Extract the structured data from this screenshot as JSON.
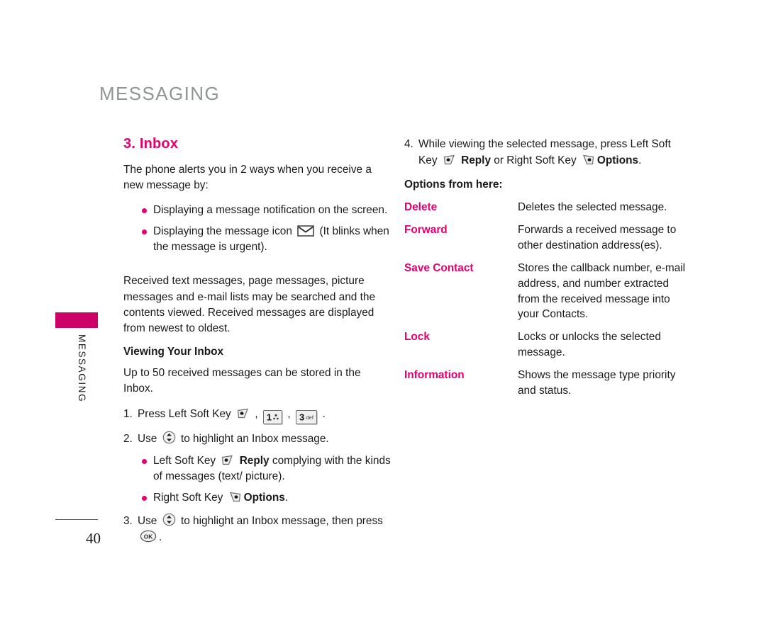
{
  "page": {
    "chapter_title": "MESSAGING",
    "side_tab_label": "MESSAGING",
    "page_number": "40",
    "accent_color": "#E4006D",
    "tab_color": "#CC0066",
    "chapter_title_color": "#8F9591"
  },
  "left": {
    "section_heading": "3. Inbox",
    "intro": "The phone alerts you in 2 ways when you receive a new message by:",
    "alert_bullets": [
      {
        "before": "Displaying a message notification on the screen.",
        "icon": null,
        "after": ""
      },
      {
        "before": "Displaying the message icon",
        "icon": "envelope-icon",
        "after": "(It blinks when the message is urgent)."
      }
    ],
    "paragraph_received": "Received text messages, page messages, picture messages and e-mail lists may be searched and the contents viewed. Received messages are displayed from newest to oldest.",
    "subhead_viewing": "Viewing Your Inbox",
    "paragraph_capacity": "Up to 50 received messages can be stored in the Inbox.",
    "steps": [
      {
        "num": "1.",
        "text_before": "Press Left Soft Key",
        "icons": [
          "left-soft-key-icon",
          "key-1-icon",
          "key-3-icon"
        ],
        "text_after": "."
      },
      {
        "num": "2.",
        "text_before": "Use",
        "icons": [
          "nav-up-down-icon"
        ],
        "text_after": "to highlight an Inbox message."
      },
      {
        "num": "3.",
        "text_before": "Use",
        "icons": [
          "nav-up-down-icon"
        ],
        "text_after": "to highlight an Inbox message, then press",
        "trailing_icon": "ok-key-icon",
        "trailing_text": "."
      }
    ],
    "softkey_bullets": [
      {
        "prefix": "Left Soft Key",
        "icon": "left-soft-key-icon",
        "bold": "Reply",
        "suffix": "complying with the kinds of messages (text/ picture)."
      },
      {
        "prefix": "Right Soft Key",
        "icon": "right-soft-key-icon",
        "bold": "Options",
        "suffix": "."
      }
    ],
    "keycaps": {
      "key1_digit": "1",
      "key1_sub": "",
      "key3_digit": "3",
      "key3_sub": "def"
    }
  },
  "right": {
    "step4": {
      "num": "4.",
      "part1": "While viewing the selected message, press Left Soft Key",
      "bold1": "Reply",
      "part2": "or Right Soft Key",
      "bold2": "Options",
      "part3": "."
    },
    "options_heading": "Options from here:",
    "options": [
      {
        "name": "Delete",
        "description": "Deletes the selected message."
      },
      {
        "name": "Forward",
        "description": "Forwards a received message to other destination address(es)."
      },
      {
        "name": "Save Contact",
        "description": "Stores the callback number, e-mail address, and number extracted from the received message into your Contacts."
      },
      {
        "name": "Lock",
        "description": "Locks or unlocks the selected message."
      },
      {
        "name": "Information",
        "description": "Shows the message type priority and status."
      }
    ]
  }
}
